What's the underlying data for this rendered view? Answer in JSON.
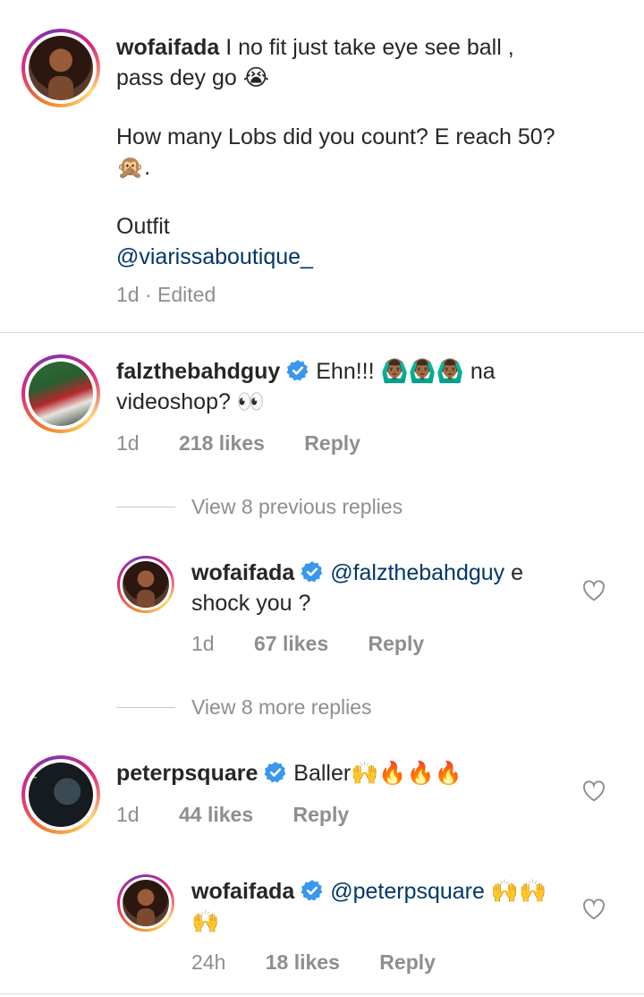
{
  "caption": {
    "username": "wofaifada",
    "line1": "I no fit just take eye see ball ,",
    "line2": "pass dey go 😭",
    "line3": "How many Lobs did you count? E reach 50?",
    "line4": "🙊.",
    "line5": "Outfit",
    "mention": "@viarissaboutique_",
    "meta": "1d · Edited"
  },
  "comments": [
    {
      "username": "falzthebahdguy",
      "text_a": "Ehn!!! 🙆🏾‍♂️🙆🏾‍♂️🙆🏾‍♂️ na",
      "text_b": "videoshop? 👀",
      "time": "1d",
      "likes": "218 likes",
      "reply": "Reply"
    },
    {
      "username": "wofaifada",
      "mention": "@falzthebahdguy",
      "text_a": " e",
      "text_b": "shock you ?",
      "time": "1d",
      "likes": "67 likes",
      "reply": "Reply"
    },
    {
      "username": "peterpsquare",
      "text_a": "Baller🙌🔥🔥🔥",
      "time": "1d",
      "likes": "44 likes",
      "reply": "Reply"
    },
    {
      "username": "wofaifada",
      "mention": "@peterpsquare",
      "text_a": " 🙌🙌",
      "text_b": "🙌",
      "time": "24h",
      "likes": "18 likes",
      "reply": "Reply"
    }
  ],
  "view_previous": "View 8 previous replies",
  "view_more": "View 8 more replies",
  "colors": {
    "verified": "#3897f0",
    "mention": "#00376b",
    "meta": "#8e8e8e"
  }
}
